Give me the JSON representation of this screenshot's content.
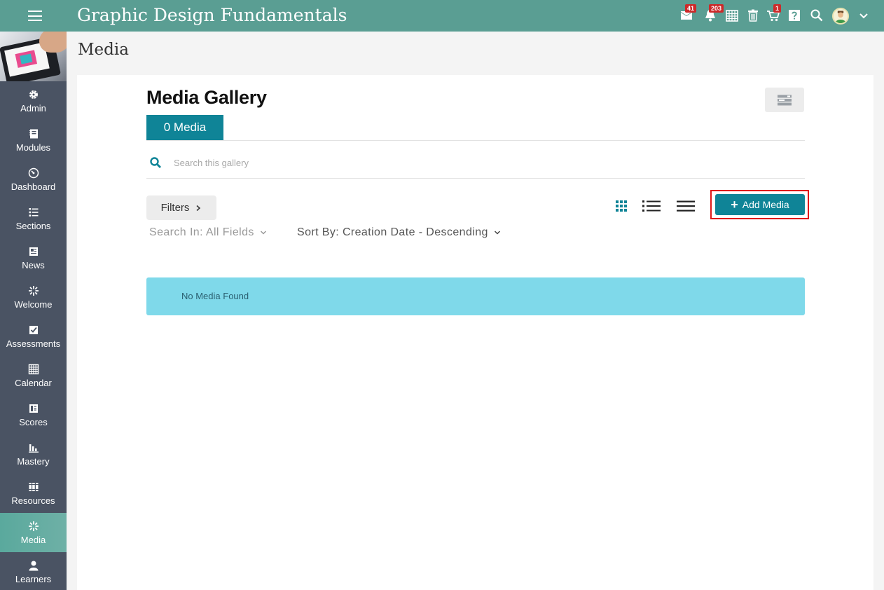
{
  "header": {
    "title": "Graphic Design Fundamentals",
    "badges": {
      "messages": "41",
      "notifications": "203",
      "cart": "1"
    }
  },
  "sidebar": {
    "items": [
      {
        "label": "Admin",
        "icon": "gear-icon"
      },
      {
        "label": "Modules",
        "icon": "notebook-icon"
      },
      {
        "label": "Dashboard",
        "icon": "gauge-icon"
      },
      {
        "label": "Sections",
        "icon": "list-icon"
      },
      {
        "label": "News",
        "icon": "newspaper-icon"
      },
      {
        "label": "Welcome",
        "icon": "sparkle-icon"
      },
      {
        "label": "Assessments",
        "icon": "checkbox-icon"
      },
      {
        "label": "Calendar",
        "icon": "calendar-icon"
      },
      {
        "label": "Scores",
        "icon": "scorebook-icon"
      },
      {
        "label": "Mastery",
        "icon": "bar-chart-icon"
      },
      {
        "label": "Resources",
        "icon": "books-icon"
      },
      {
        "label": "Media",
        "icon": "sparkle-icon",
        "active": true
      },
      {
        "label": "Learners",
        "icon": "person-icon"
      }
    ]
  },
  "page": {
    "title": "Media"
  },
  "gallery": {
    "title": "Media Gallery",
    "count_label": "0 Media",
    "search": {
      "placeholder": "Search this gallery",
      "value": ""
    },
    "filters_label": "Filters",
    "add_label": "Add Media",
    "search_in_label": "Search In: All Fields",
    "sort_label": "Sort By: Creation Date - Descending",
    "empty_message": "No Media Found"
  },
  "colors": {
    "topbar": "#5a9e93",
    "sidebar": "#4a5363",
    "accent": "#0f8497",
    "notice": "#7fd9ea",
    "highlight": "#e01818",
    "badge": "#cc2a2a"
  }
}
